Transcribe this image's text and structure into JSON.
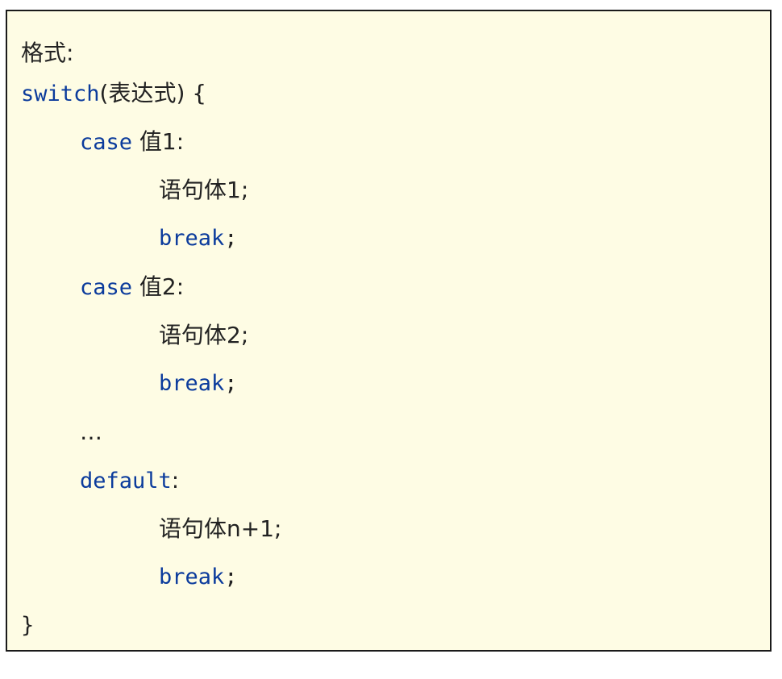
{
  "heading": "格式:",
  "code": {
    "switch_kw": "switch",
    "switch_rest": "(表达式) {",
    "case1_kw": "case",
    "case1_value": " 值1:",
    "stmt1": "语句体1;",
    "break1_kw": "break",
    "break1_semi": ";",
    "case2_kw": "case",
    "case2_value": " 值2:",
    "stmt2": "语句体2;",
    "break2_kw": "break",
    "break2_semi": ";",
    "ellipsis": "…",
    "default_kw": "default",
    "default_colon": ":",
    "stmt_n": "语句体n+1;",
    "break3_kw": "break",
    "break3_semi": ";",
    "close_brace": "}"
  },
  "colors": {
    "background": "#fefce4",
    "keyword": "#0b3b9c",
    "text": "#222222",
    "border": "#1a1a1a"
  }
}
